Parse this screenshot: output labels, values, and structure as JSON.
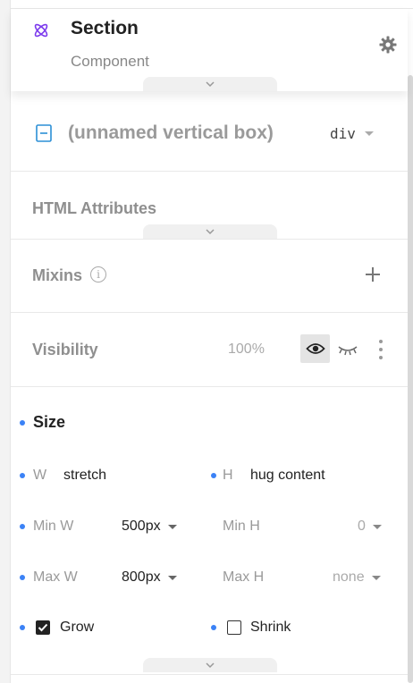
{
  "component": {
    "title": "Section",
    "subtitle": "Component",
    "icon": "component-icon",
    "settings_icon": "gear-icon"
  },
  "element": {
    "name": "(unnamed vertical box)",
    "tag": "div",
    "icon": "vertical-box-icon"
  },
  "sections": {
    "html_attributes": "HTML Attributes",
    "mixins": "Mixins",
    "visibility": "Visibility",
    "visibility_value": "100%",
    "size": "Size"
  },
  "size": {
    "w_label": "W",
    "w_value": "stretch",
    "h_label": "H",
    "h_value": "hug content",
    "min_w_label": "Min W",
    "min_w_value": "500px",
    "min_h_label": "Min H",
    "min_h_value": "0",
    "max_w_label": "Max W",
    "max_w_value": "800px",
    "max_h_label": "Max H",
    "max_h_value": "none",
    "grow_label": "Grow",
    "grow_checked": true,
    "shrink_label": "Shrink",
    "shrink_checked": false
  },
  "colors": {
    "accent_dot": "#3b82f6",
    "component_icon": "#7c3aed",
    "vbox_icon": "#2b8fd6"
  }
}
